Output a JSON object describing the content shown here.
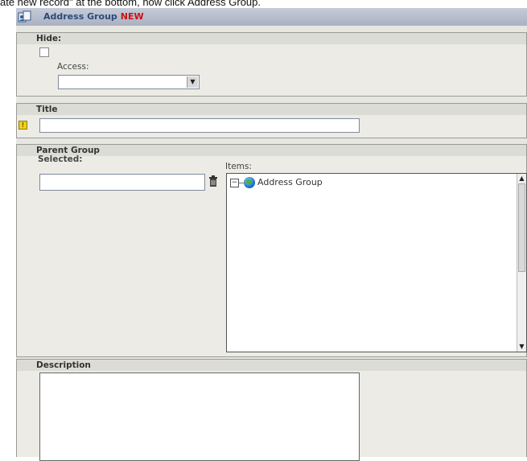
{
  "caption": "ate new record\" at the bottom, now click Address Group.",
  "header": {
    "title": "Address Group",
    "badge": "NEW",
    "icon": "record-icon"
  },
  "hide_section": {
    "label": "Hide:",
    "access_label": "Access:",
    "access_value": "",
    "checked": false
  },
  "title_section": {
    "label": "Title",
    "value": "",
    "required_icon": "!"
  },
  "parent_group": {
    "label": "Parent Group",
    "selected_label": "Selected:",
    "selected_value": "",
    "items_label": "Items:",
    "tree": [
      {
        "label": "Address Group",
        "expander": "−",
        "icon": "globe-icon"
      }
    ]
  },
  "description_section": {
    "label": "Description",
    "value": ""
  },
  "colors": {
    "title_text": "#2d4a7a",
    "new_badge": "#cc1111",
    "panel_bg": "#ecebe5"
  }
}
